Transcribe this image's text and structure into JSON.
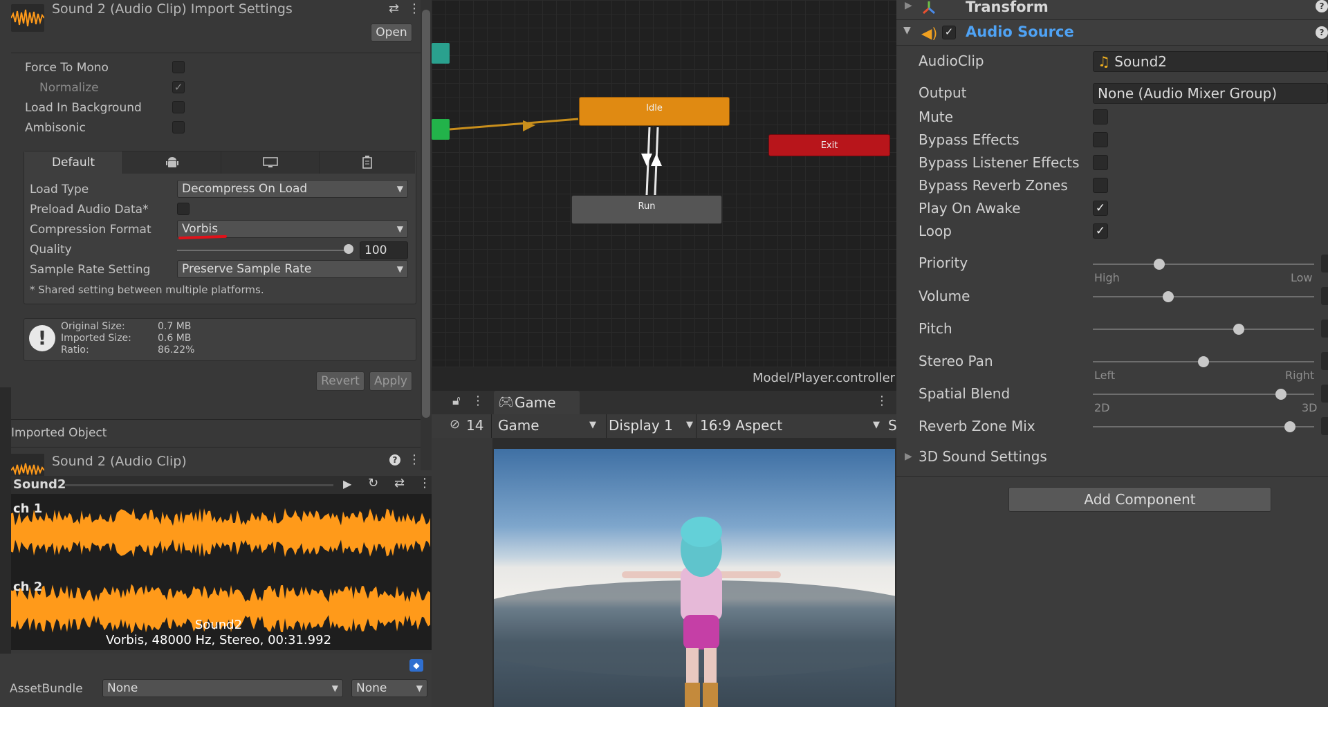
{
  "import_settings": {
    "title": "Sound 2 (Audio Clip) Import Settings",
    "open_button": "Open",
    "force_to_mono": "Force To Mono",
    "normalize": "Normalize",
    "load_in_background": "Load In Background",
    "ambisonic": "Ambisonic",
    "tabs": {
      "default": "Default"
    },
    "load_type_label": "Load Type",
    "load_type_value": "Decompress On Load",
    "preload_label": "Preload Audio Data*",
    "compression_label": "Compression Format",
    "compression_value": "Vorbis",
    "quality_label": "Quality",
    "quality_value": "100",
    "sample_rate_label": "Sample Rate Setting",
    "sample_rate_value": "Preserve Sample Rate",
    "shared_note": "* Shared setting between multiple platforms.",
    "info": {
      "original_label": "Original Size:",
      "original_value": "0.7 MB",
      "imported_label": "Imported Size:",
      "imported_value": "0.6 MB",
      "ratio_label": "Ratio:",
      "ratio_value": "86.22%"
    },
    "revert_button": "Revert",
    "apply_button": "Apply",
    "imported_object": "Imported Object",
    "clip_title": "Sound 2 (Audio Clip)",
    "preview_name": "Sound2",
    "ch1": "ch 1",
    "ch2": "ch 2",
    "wave_name": "Sound2",
    "wave_info": "Vorbis, 48000 Hz, Stereo, 00:31.992",
    "assetbundle_label": "AssetBundle",
    "assetbundle_value": "None",
    "assetbundle_variant": "None"
  },
  "animator": {
    "idle": "Idle",
    "exit": "Exit",
    "run": "Run",
    "path": "Model/Player.controller"
  },
  "game_view": {
    "tab": "Game",
    "count": "14",
    "mode": "Game",
    "display": "Display 1",
    "aspect": "16:9 Aspect",
    "cut": "S"
  },
  "inspector": {
    "transform": "Transform",
    "audio_source": "Audio Source",
    "audioclip_label": "AudioClip",
    "audioclip_value": "Sound2",
    "output_label": "Output",
    "output_value": "None (Audio Mixer Group)",
    "mute": "Mute",
    "bypass_effects": "Bypass Effects",
    "bypass_listener": "Bypass Listener Effects",
    "bypass_reverb": "Bypass Reverb Zones",
    "play_on_awake": "Play On Awake",
    "loop": "Loop",
    "priority": "Priority",
    "priority_high": "High",
    "priority_low": "Low",
    "volume": "Volume",
    "pitch": "Pitch",
    "stereo_pan": "Stereo Pan",
    "pan_left": "Left",
    "pan_right": "Right",
    "spatial_blend": "Spatial Blend",
    "blend_2d": "2D",
    "blend_3d": "3D",
    "reverb_mix": "Reverb Zone Mix",
    "sound3d": "3D Sound Settings",
    "add_component": "Add Component",
    "slider_levels": {
      "priority": 0.3,
      "volume": 0.34,
      "pitch": 0.66,
      "stereo_pan": 0.5,
      "spatial_blend": 0.85,
      "reverb_mix": 0.89
    }
  },
  "colors": {
    "idle": "#e08a12",
    "exit": "#b8151b",
    "accent_blue": "#4fa3f5",
    "waveform": "#ff9a1a"
  }
}
